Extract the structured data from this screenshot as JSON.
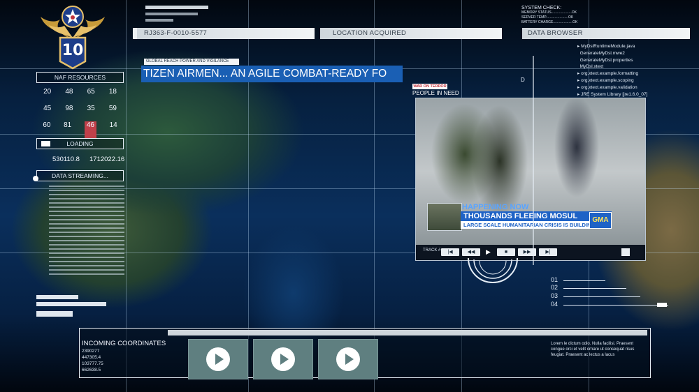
{
  "top_bars": {
    "id_code": "RJ363-F-0010-5577",
    "location": "LOCATION ACQUIRED",
    "data_browser": "DATA BROWSER"
  },
  "system_check": {
    "title": "SYSTEM CHECK:",
    "lines": [
      {
        "label": "MEMORY STATUS.....................",
        "value": "OK"
      },
      {
        "label": "SERVER TEMP.......................",
        "value": "OK"
      },
      {
        "label": "BATTERY CHARGE....................",
        "value": "OK"
      }
    ]
  },
  "emblem": {
    "number": "10"
  },
  "naf_resources": {
    "label": "NAF RESOURCES",
    "rows": [
      [
        "20",
        "48",
        "65",
        "18"
      ],
      [
        "45",
        "98",
        "35",
        "59"
      ],
      [
        "60",
        "81",
        "46",
        "14"
      ]
    ],
    "highlight": "46"
  },
  "loading": {
    "label": "LOADING",
    "progress": 0.12
  },
  "readout": {
    "left": "530110.8",
    "right": "1712022.16"
  },
  "data_streaming": {
    "label": "DATA STREAMING..."
  },
  "ticker": {
    "tag": "GLOBAL REACH POWER AND VIGILANCE",
    "text": "TIZEN AIRMEN... AN AGILE COMBAT-READY FO"
  },
  "news": {
    "tag": "WAR ON TERROR",
    "title": "PEOPLE IN NEED",
    "happening_now": "HAPPENING NOW",
    "headline": "THOUSANDS FLEEING MOSUL",
    "subhead": "LARGE SCALE HUMANITARIAN CRISIS IS BUILDING",
    "network": "GMA",
    "track_label": "TRACK #"
  },
  "file_browser": {
    "items": [
      "MyDslRuntimeModule.java",
      "GenerateMyDsl.mwe2",
      "GenerateMyDsl.properties",
      "MyDsl.xtext",
      "org.xtext.example.formatting",
      "org.xtext.example.scoping",
      "org.xtext.example.validation",
      "JRE System Library [jre1.6.0_07]"
    ]
  },
  "right_numbers": [
    "01",
    "02",
    "03",
    "04"
  ],
  "bottom": {
    "incoming_label": "INCOMING COORDINATES",
    "coords": [
      "2390277",
      "447305.4",
      "103777.75",
      "662638.5"
    ],
    "lorem": "Lorem le dictum odio. Nulla facilisi. Praesent congue orci et velit ornare ut consequat risus feugiat. Praesent ac lectus a lacus"
  },
  "colors": {
    "accent_blue": "#1a5fb4",
    "news_blue": "#1f63c6",
    "play_teal": "#5f7f80",
    "highlight_red": "#c0404a"
  }
}
